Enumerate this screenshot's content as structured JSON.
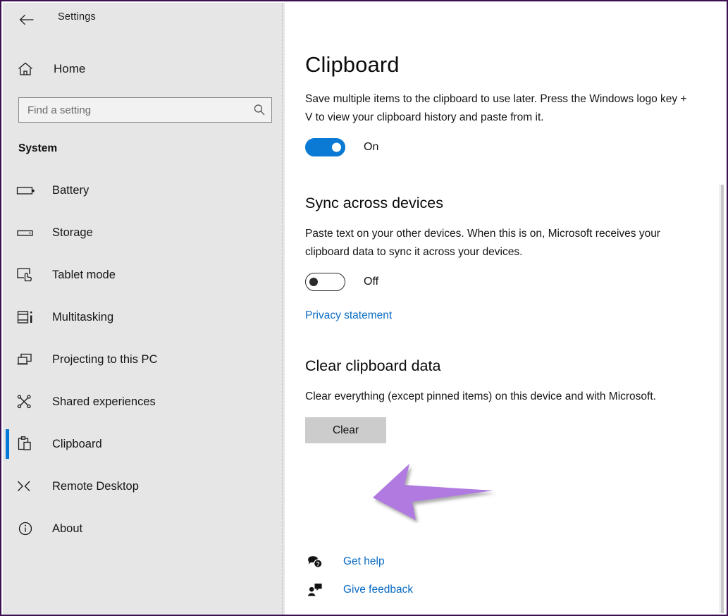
{
  "window": {
    "title": "Settings",
    "back_icon": "back-arrow-icon",
    "controls": {
      "minimize": "minimize-icon",
      "maximize": "maximize-icon",
      "close": "close-icon"
    }
  },
  "sidebar": {
    "home": {
      "label": "Home",
      "icon": "home-icon"
    },
    "search": {
      "placeholder": "Find a setting",
      "value": "",
      "icon": "search-icon"
    },
    "group_header": "System",
    "items": [
      {
        "label": "Battery",
        "icon": "battery-icon",
        "selected": false
      },
      {
        "label": "Storage",
        "icon": "storage-icon",
        "selected": false
      },
      {
        "label": "Tablet mode",
        "icon": "tablet-mode-icon",
        "selected": false
      },
      {
        "label": "Multitasking",
        "icon": "multitasking-icon",
        "selected": false
      },
      {
        "label": "Projecting to this PC",
        "icon": "projecting-icon",
        "selected": false
      },
      {
        "label": "Shared experiences",
        "icon": "shared-experiences-icon",
        "selected": false
      },
      {
        "label": "Clipboard",
        "icon": "clipboard-icon",
        "selected": true
      },
      {
        "label": "Remote Desktop",
        "icon": "remote-desktop-icon",
        "selected": false
      },
      {
        "label": "About",
        "icon": "about-info-icon",
        "selected": false
      }
    ]
  },
  "main": {
    "page_title": "Clipboard",
    "clipboard_history": {
      "description": "Save multiple items to the clipboard to use later. Press the Windows logo key + V to view your clipboard history and paste from it.",
      "toggle_state": "On"
    },
    "sync": {
      "title": "Sync across devices",
      "description": "Paste text on your other devices. When this is on, Microsoft receives your clipboard data to sync it across your devices.",
      "toggle_state": "Off",
      "privacy_link": "Privacy statement"
    },
    "clear": {
      "title": "Clear clipboard data",
      "description": "Clear everything (except pinned items) on this device and with Microsoft.",
      "button_label": "Clear"
    }
  },
  "help": {
    "items": [
      {
        "label": "Get help",
        "icon": "get-help-icon"
      },
      {
        "label": "Give feedback",
        "icon": "give-feedback-icon"
      }
    ]
  },
  "annotation": {
    "arrow_color": "#b07ae0",
    "arrow_direction": "left"
  },
  "colors": {
    "accent": "#0078d7",
    "link": "#0a6cc4",
    "sidebar_bg": "#e6e6e6",
    "window_border": "#3b1053",
    "button_bg": "#cccccc"
  }
}
